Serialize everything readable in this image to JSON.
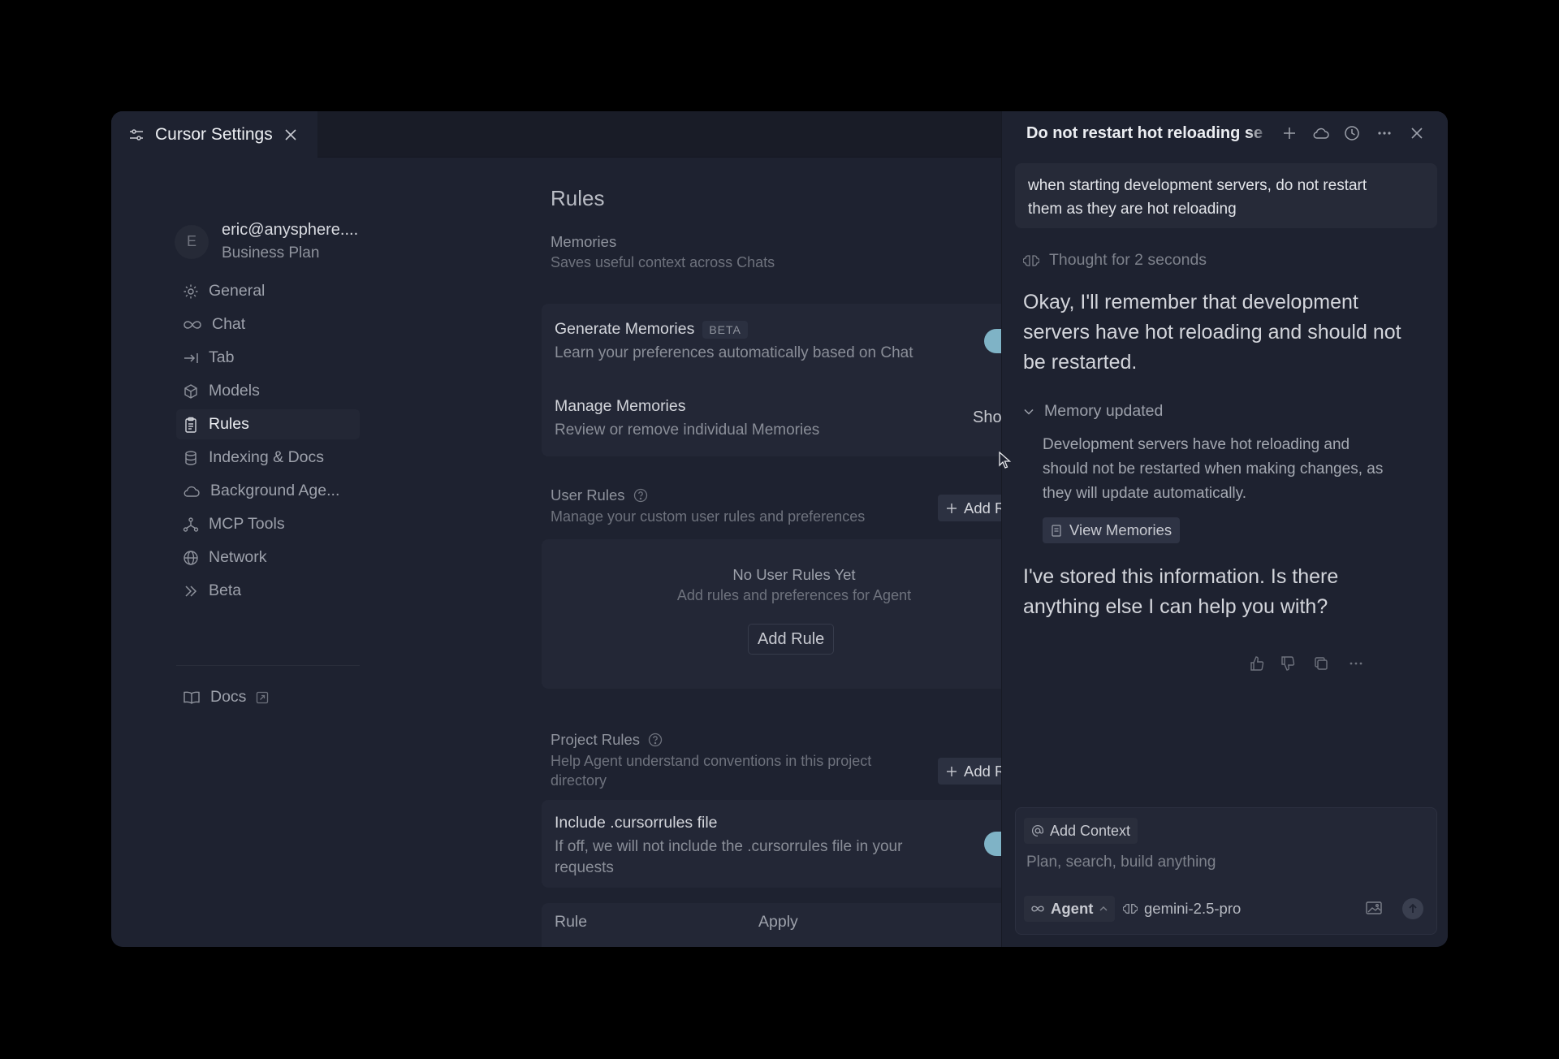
{
  "settings_tab": {
    "title": "Cursor Settings",
    "icon": "sliders-icon",
    "close_icon": "close-icon"
  },
  "account": {
    "avatar_initial": "E",
    "email": "eric@anysphere....",
    "plan": "Business Plan"
  },
  "sidebar": {
    "items": [
      {
        "label": "General",
        "icon": "gear-icon",
        "active": false
      },
      {
        "label": "Chat",
        "icon": "infinity-icon",
        "active": false
      },
      {
        "label": "Tab",
        "icon": "tab-arrow-icon",
        "active": false
      },
      {
        "label": "Models",
        "icon": "cube-icon",
        "active": false
      },
      {
        "label": "Rules",
        "icon": "clipboard-icon",
        "active": true
      },
      {
        "label": "Indexing & Docs",
        "icon": "database-icon",
        "active": false
      },
      {
        "label": "Background Age...",
        "icon": "cloud-icon",
        "active": false
      },
      {
        "label": "MCP Tools",
        "icon": "network-nodes-icon",
        "active": false
      },
      {
        "label": "Network",
        "icon": "globe-icon",
        "active": false
      },
      {
        "label": "Beta",
        "icon": "double-chevron-icon",
        "active": false
      }
    ],
    "docs": {
      "label": "Docs",
      "icon": "book-icon",
      "external_icon": "external-link-icon"
    }
  },
  "main": {
    "title": "Rules",
    "memories": {
      "title": "Memories",
      "description": "Saves useful context across Chats",
      "generate": {
        "title": "Generate Memories",
        "badge": "BETA",
        "description": "Learn your preferences automatically based on Chat",
        "enabled": true
      },
      "manage": {
        "title": "Manage Memories",
        "description": "Review or remove individual Memories",
        "button": "Show"
      }
    },
    "user_rules": {
      "title": "User Rules",
      "description": "Manage your custom user rules and preferences",
      "add_button": "Add Rule",
      "empty_title": "No User Rules Yet",
      "empty_description": "Add rules and preferences for Agent",
      "empty_button": "Add Rule"
    },
    "project_rules": {
      "title": "Project Rules",
      "description_line1": "Help Agent understand conventions in this project",
      "description_line2": "directory",
      "add_button": "Add Rule",
      "include": {
        "title": "Include .cursorrules file",
        "description_line1": "If off, we will not include the .cursorrules file in your",
        "description_line2": "requests",
        "enabled": true
      },
      "table_headers": [
        "Rule",
        "Apply"
      ]
    }
  },
  "chat": {
    "title": "Do not restart hot reloading se",
    "header_icons": [
      "plus-icon",
      "cloud-icon",
      "history-icon",
      "more-icon",
      "close-icon"
    ],
    "user_message_line1": "when starting development servers, do not restart",
    "user_message_line2": "them as they are hot reloading",
    "thought": "Thought for 2 seconds",
    "reply1_line1": "Okay, I'll remember that development",
    "reply1_line2": "servers have hot reloading and should not",
    "reply1_line3": "be restarted.",
    "memory_header": "Memory updated",
    "memory_body_line1": "Development servers have hot reloading and",
    "memory_body_line2": "should not be restarted when making changes, as",
    "memory_body_line3": "they will update automatically.",
    "view_memories": "View Memories",
    "reply2_line1": "I've stored this information. Is there",
    "reply2_line2": "anything else I can help you with?",
    "message_actions": [
      "thumbs-up-icon",
      "thumbs-down-icon",
      "copy-icon",
      "more-icon"
    ],
    "composer": {
      "add_context": "Add Context",
      "placeholder": "Plan, search, build anything",
      "mode": "Agent",
      "model": "gemini-2.5-pro"
    }
  },
  "colors": {
    "background": "#000000",
    "window": "#1e2230",
    "card": "#232736",
    "toggle_on": "#7fb3c6"
  }
}
